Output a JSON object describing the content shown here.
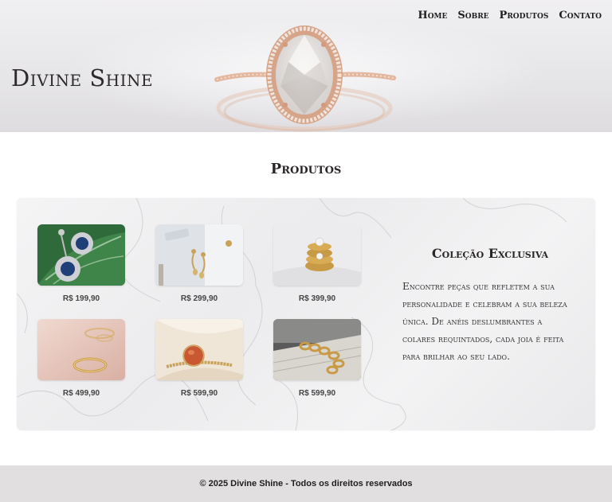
{
  "brand": {
    "name": "Divine Shine"
  },
  "nav": {
    "items": [
      {
        "label": "Home"
      },
      {
        "label": "Sobre"
      },
      {
        "label": "Produtos"
      },
      {
        "label": "Contato"
      }
    ]
  },
  "products_section": {
    "title": "Produtos",
    "items": [
      {
        "price": "R$ 199,90",
        "image": "emerald-leaf-earrings"
      },
      {
        "price": "R$ 299,90",
        "image": "gold-drop-earrings"
      },
      {
        "price": "R$ 399,90",
        "image": "stacked-gold-rings"
      },
      {
        "price": "R$ 499,90",
        "image": "gold-ring-on-pink"
      },
      {
        "price": "R$ 599,90",
        "image": "coral-stone-ring"
      },
      {
        "price": "R$ 599,90",
        "image": "gold-chain-bracelet"
      }
    ]
  },
  "collection": {
    "title": "Coleção Exclusiva",
    "text": "Encontre peças que refletem a sua personalidade e celebram a sua beleza única. De anéis deslumbrantes a colares requintados, cada joia é feita para brilhar ao seu lado."
  },
  "footer": {
    "text": "© 2025 Divine Shine - Todos os direitos reservados"
  },
  "colors": {
    "footer_bg": "#e1dfe0",
    "hero_bg": "#e7e6e9",
    "rose_gold": "#d9a58a"
  }
}
